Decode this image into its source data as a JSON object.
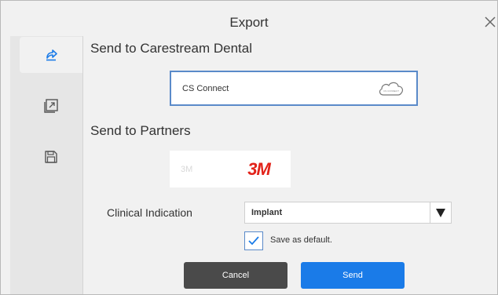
{
  "dialog": {
    "title": "Export"
  },
  "sections": {
    "carestream_heading": "Send to Carestream Dental",
    "partners_heading": "Send to Partners"
  },
  "cs_connect": {
    "label": "CS Connect",
    "icon_text": "CS CONNECT"
  },
  "partner": {
    "name": "3M",
    "logo": "3M"
  },
  "clinical_indication": {
    "label": "Clinical Indication",
    "value": "Implant"
  },
  "save_default": {
    "label": "Save as default.",
    "checked": true
  },
  "buttons": {
    "cancel": "Cancel",
    "send": "Send"
  },
  "sidebar": {
    "items": [
      {
        "icon": "share-icon",
        "active": true
      },
      {
        "icon": "export-file-icon",
        "active": false
      },
      {
        "icon": "save-icon",
        "active": false
      }
    ]
  },
  "colors": {
    "accent": "#1a7be8",
    "brand_3m": "#e2231a",
    "border_selected": "#5a8ac9"
  }
}
